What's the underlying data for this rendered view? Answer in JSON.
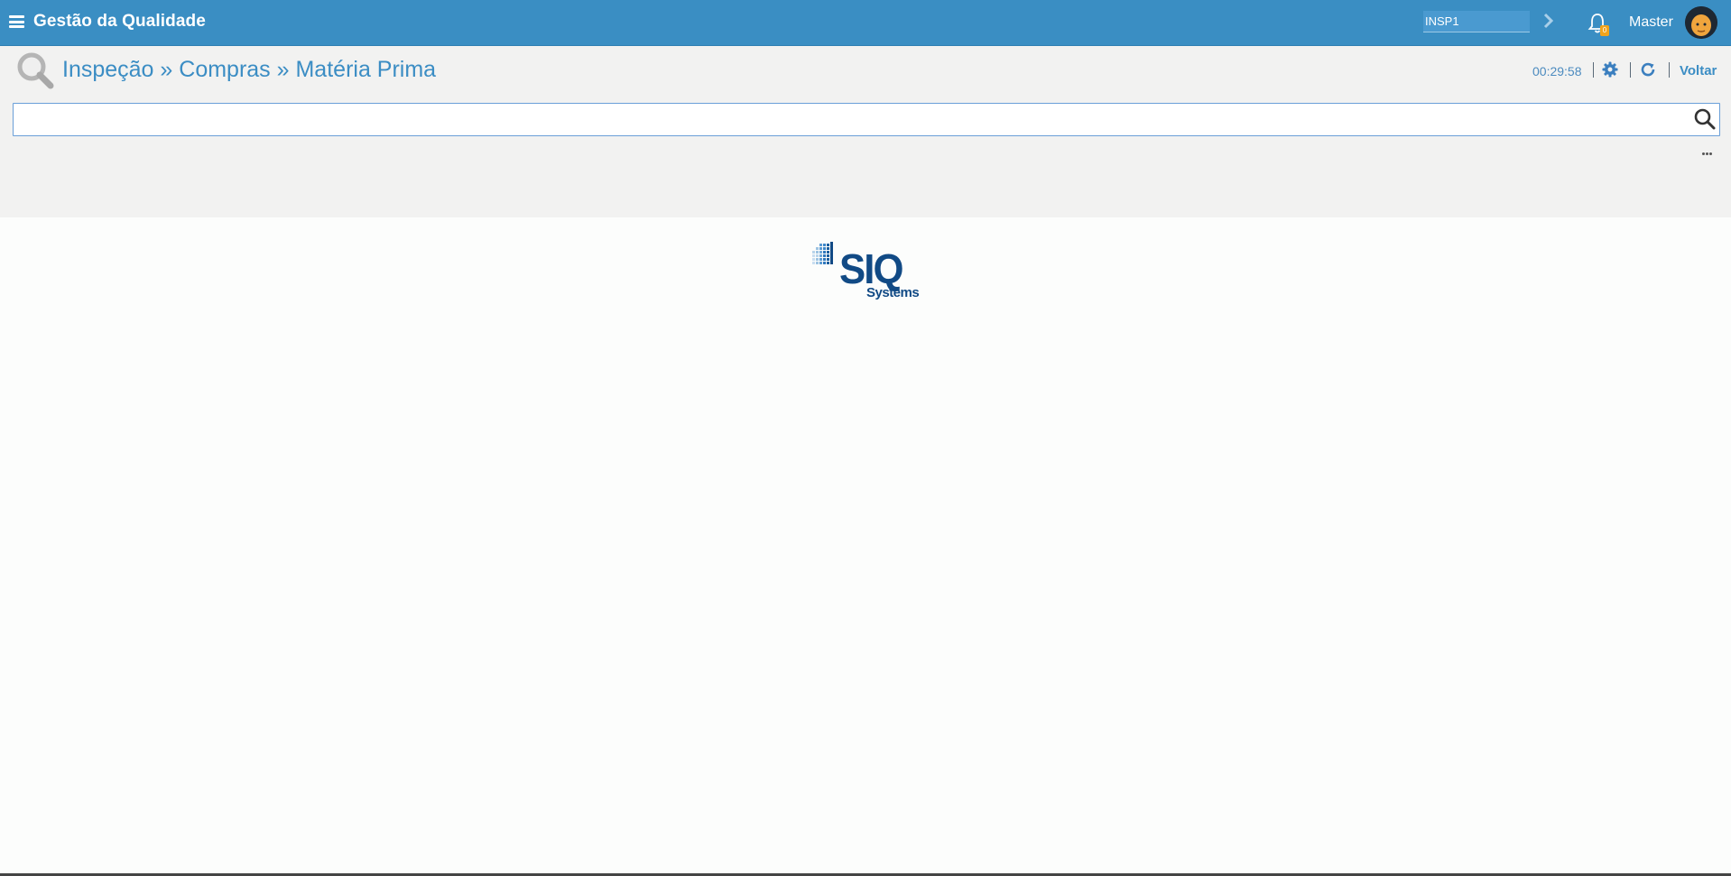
{
  "header": {
    "app_title": "Gestão da Qualidade",
    "company_code": "INSP1",
    "notification_count": "0",
    "user_name": "Master"
  },
  "subheader": {
    "breadcrumb": [
      "Inspeção",
      " » ",
      "Compras",
      " » ",
      "Matéria Prima"
    ],
    "timer": "00:29:58",
    "back_label": "Voltar"
  },
  "search": {
    "value": "",
    "placeholder": ""
  },
  "logo": {
    "main": "SIQ",
    "sub": "Systems"
  },
  "colors": {
    "topbar": "#3a8ec3",
    "accent": "#3b8dc4",
    "badge": "#f2a41b",
    "logo": "#114a85"
  },
  "icons": [
    "menu-icon",
    "chevron-right-icon",
    "bell-icon",
    "avatar",
    "search-icon",
    "gear-icon",
    "refresh-icon",
    "more-icon"
  ]
}
